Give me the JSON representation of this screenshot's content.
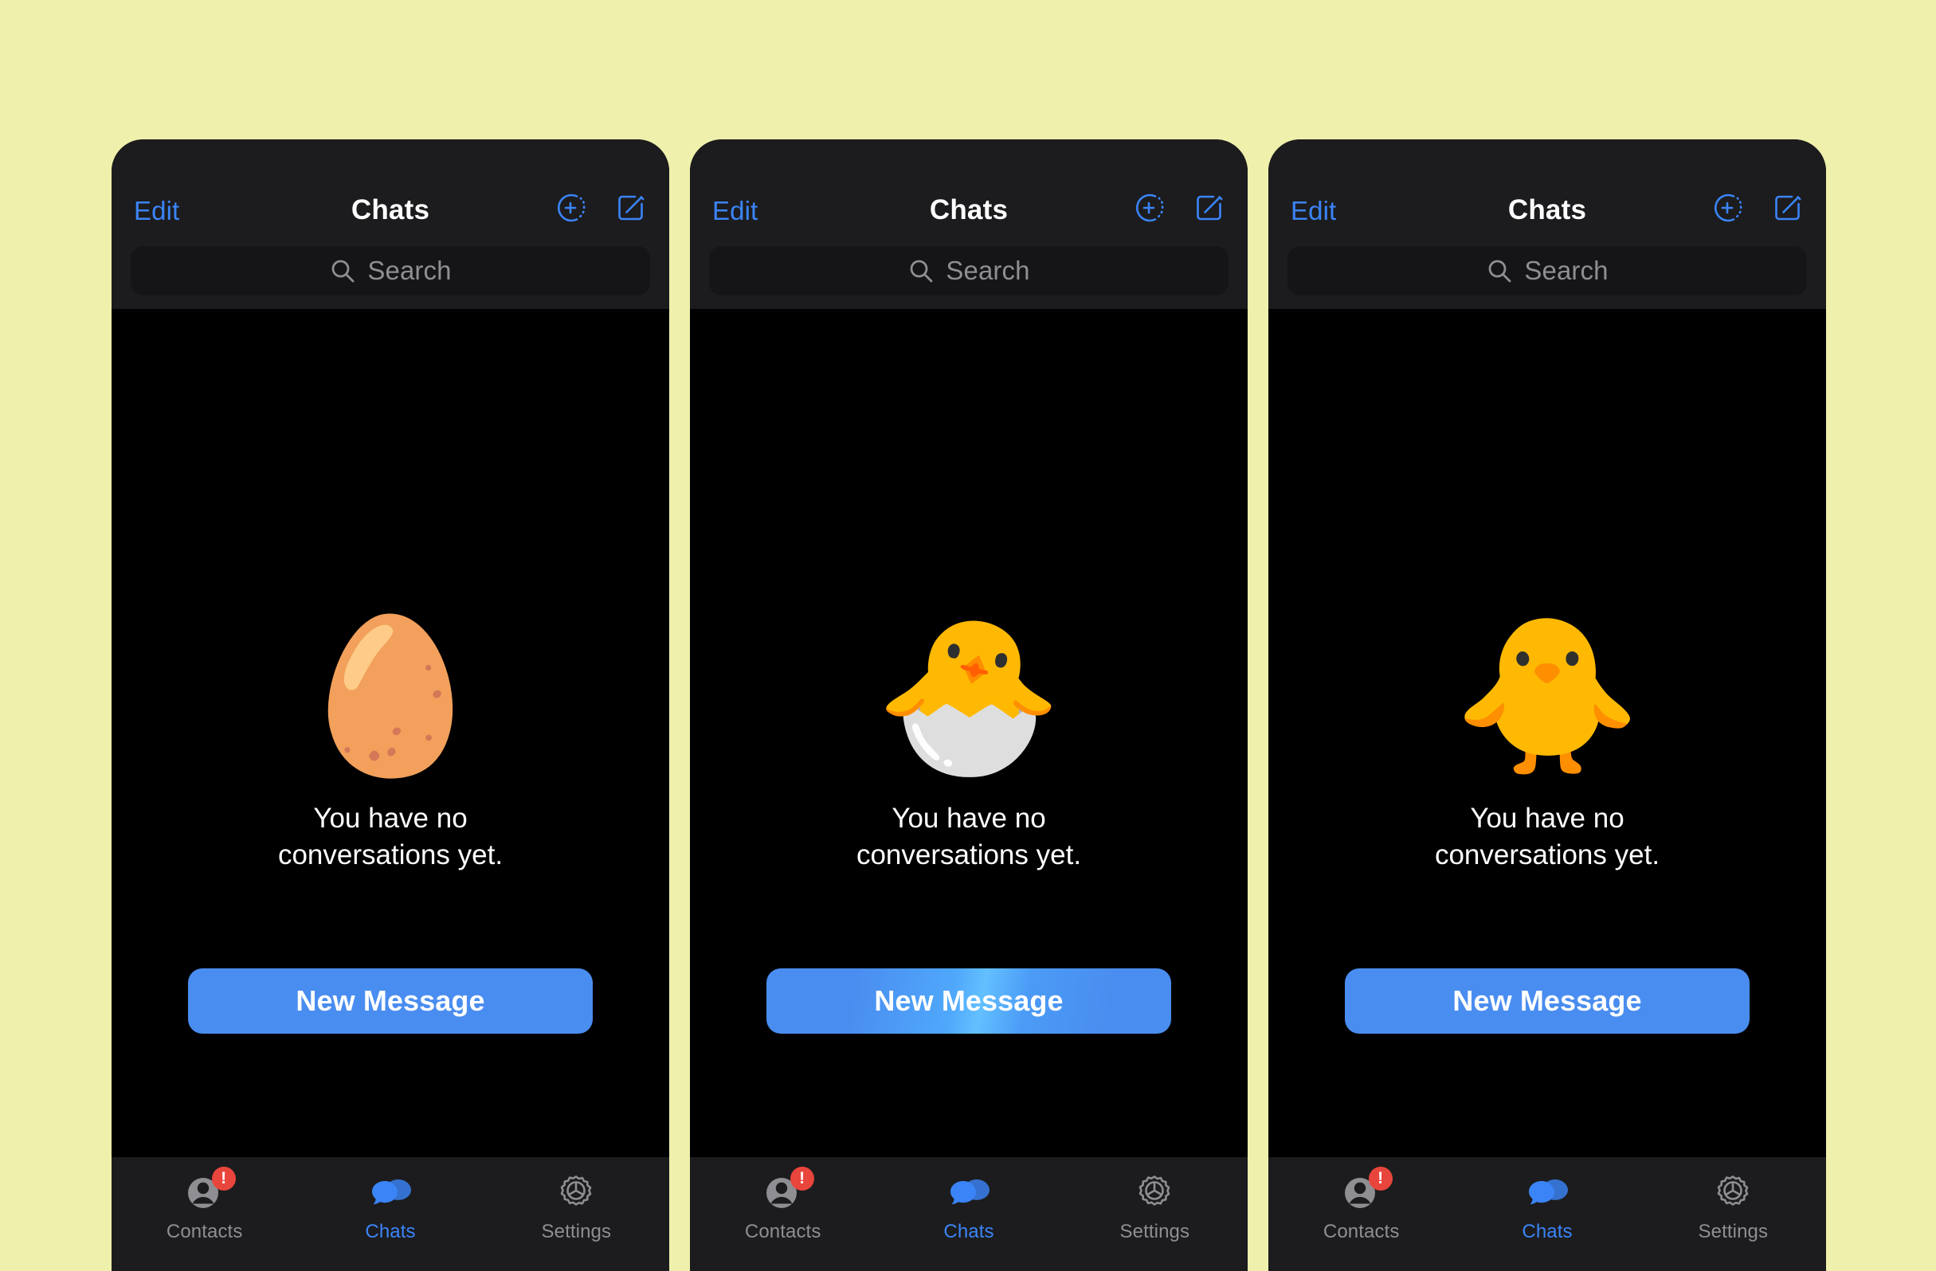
{
  "background_color": "#eff0ab",
  "accent_color": "#3b84f7",
  "panels": [
    {
      "id": "panel-egg",
      "nav": {
        "edit_label": "Edit",
        "title": "Chats",
        "add_icon": "add-person-circle-icon",
        "compose_icon": "compose-square-icon"
      },
      "search": {
        "placeholder": "Search",
        "icon": "search-icon",
        "value": ""
      },
      "empty_state": {
        "art": "🥚",
        "art_name": "egg-emoji",
        "line1": "You have no",
        "line2": "conversations yet."
      },
      "cta": {
        "label": "New Message",
        "style": "flat",
        "color": "#4a8df0"
      },
      "tabs": [
        {
          "label": "Contacts",
          "icon": "contacts-person-icon",
          "active": false,
          "badge": "!"
        },
        {
          "label": "Chats",
          "icon": "chat-bubbles-icon",
          "active": true,
          "badge": ""
        },
        {
          "label": "Settings",
          "icon": "gear-icon",
          "active": false,
          "badge": ""
        }
      ]
    },
    {
      "id": "panel-hatching",
      "nav": {
        "edit_label": "Edit",
        "title": "Chats",
        "add_icon": "add-person-circle-icon",
        "compose_icon": "compose-square-icon"
      },
      "search": {
        "placeholder": "Search",
        "icon": "search-icon",
        "value": ""
      },
      "empty_state": {
        "art": "🐣",
        "art_name": "hatching-chick-emoji",
        "line1": "You have no",
        "line2": "conversations yet."
      },
      "cta": {
        "label": "New Message",
        "style": "shimmer",
        "color": "#4a8df0"
      },
      "tabs": [
        {
          "label": "Contacts",
          "icon": "contacts-person-icon",
          "active": false,
          "badge": "!"
        },
        {
          "label": "Chats",
          "icon": "chat-bubbles-icon",
          "active": true,
          "badge": ""
        },
        {
          "label": "Settings",
          "icon": "gear-icon",
          "active": false,
          "badge": ""
        }
      ]
    },
    {
      "id": "panel-chick",
      "nav": {
        "edit_label": "Edit",
        "title": "Chats",
        "add_icon": "add-person-circle-icon",
        "compose_icon": "compose-square-icon"
      },
      "search": {
        "placeholder": "Search",
        "icon": "search-icon",
        "value": ""
      },
      "empty_state": {
        "art": "🐥",
        "art_name": "baby-chick-emoji",
        "line1": "You have no",
        "line2": "conversations yet."
      },
      "cta": {
        "label": "New Message",
        "style": "flat",
        "color": "#4a8df0"
      },
      "tabs": [
        {
          "label": "Contacts",
          "icon": "contacts-person-icon",
          "active": false,
          "badge": "!"
        },
        {
          "label": "Chats",
          "icon": "chat-bubbles-icon",
          "active": true,
          "badge": ""
        },
        {
          "label": "Settings",
          "icon": "gear-icon",
          "active": false,
          "badge": ""
        }
      ]
    }
  ]
}
